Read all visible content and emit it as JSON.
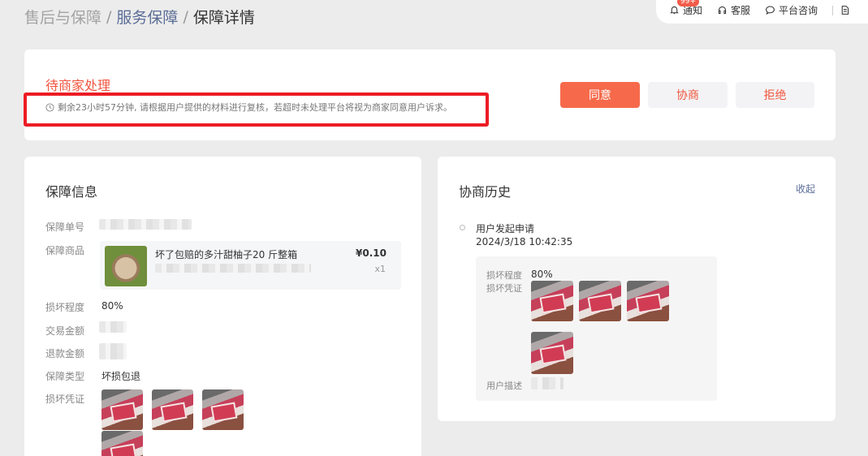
{
  "breadcrumb": {
    "root": "售后与保障",
    "sep": "/",
    "link": "服务保障",
    "current": "保障详情"
  },
  "topbar": {
    "notify_label": "通知",
    "notify_badge": "99+",
    "service_label": "客服",
    "consult_label": "平台咨询"
  },
  "status": {
    "title": "待商家处理",
    "description": "剩余23小时57分钟, 请根据用户提供的材料进行复核，若超时未处理平台将视为商家同意用户诉求。",
    "agree_label": "同意",
    "negotiate_label": "协商",
    "reject_label": "拒绝"
  },
  "info": {
    "title": "保障信息",
    "order_no_label": "保障单号",
    "product_label": "保障商品",
    "product": {
      "name": "坏了包赔的多汁甜柚子20 斤整箱",
      "price": "¥0.10",
      "qty": "x1"
    },
    "damage_label": "损坏程度",
    "damage_value": "80%",
    "trade_amount_label": "交易金额",
    "refund_amount_label": "退款金额",
    "type_label": "保障类型",
    "type_value": "坏损包退",
    "evidence_label": "损坏凭证"
  },
  "history": {
    "title": "协商历史",
    "collapse_label": "收起",
    "event": "用户发起申请",
    "time": "2024/3/18 10:42:35",
    "damage_label": "损坏程度",
    "damage_value": "80%",
    "evidence_label": "损坏凭证",
    "desc_label": "用户描述"
  },
  "colors": {
    "accent": "#f66a4b",
    "status_red": "#f0563f",
    "link_blue": "#5b6d97",
    "highlight_red": "#ec1c24"
  }
}
